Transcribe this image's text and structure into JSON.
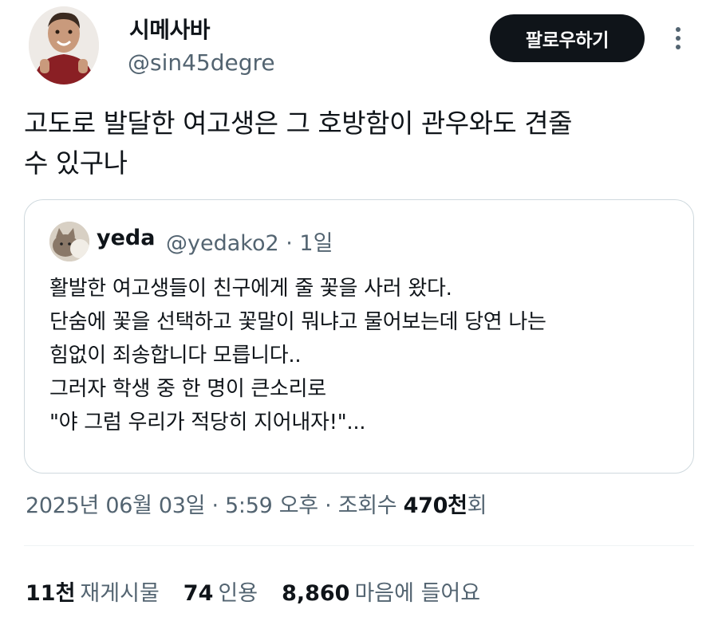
{
  "author": {
    "display_name": "시메사바",
    "handle": "@sin45degre"
  },
  "actions": {
    "follow_label": "팔로우하기"
  },
  "tweet": {
    "lines": [
      "고도로 발달한 여고생은 그 호방함이 관우와도 견줄",
      "수 있구나"
    ]
  },
  "quote": {
    "name": "yeda",
    "handle_time": "@yedako2 · 1일",
    "lines": [
      "활발한 여고생들이 친구에게 줄 꽃을 사러 왔다.",
      "단숨에 꽃을 선택하고 꽃말이 뭐냐고 물어보는데 당연 나는",
      "힘없이 죄송합니다 모릅니다..",
      "그러자 학생 중 한 명이 큰소리로",
      "\"야 그럼 우리가 적당히 지어내자!\"..."
    ]
  },
  "meta": {
    "date_time": "2025년 06월 03일 · 5:59 오후 · 조회수 ",
    "views_count": "470천",
    "views_suffix": "회"
  },
  "stats": {
    "retweets_count": "11천",
    "retweets_label": "재게시물",
    "quotes_count": "74",
    "quotes_label": "인용",
    "likes_count": "8,860",
    "likes_label": "마음에 들어요"
  }
}
